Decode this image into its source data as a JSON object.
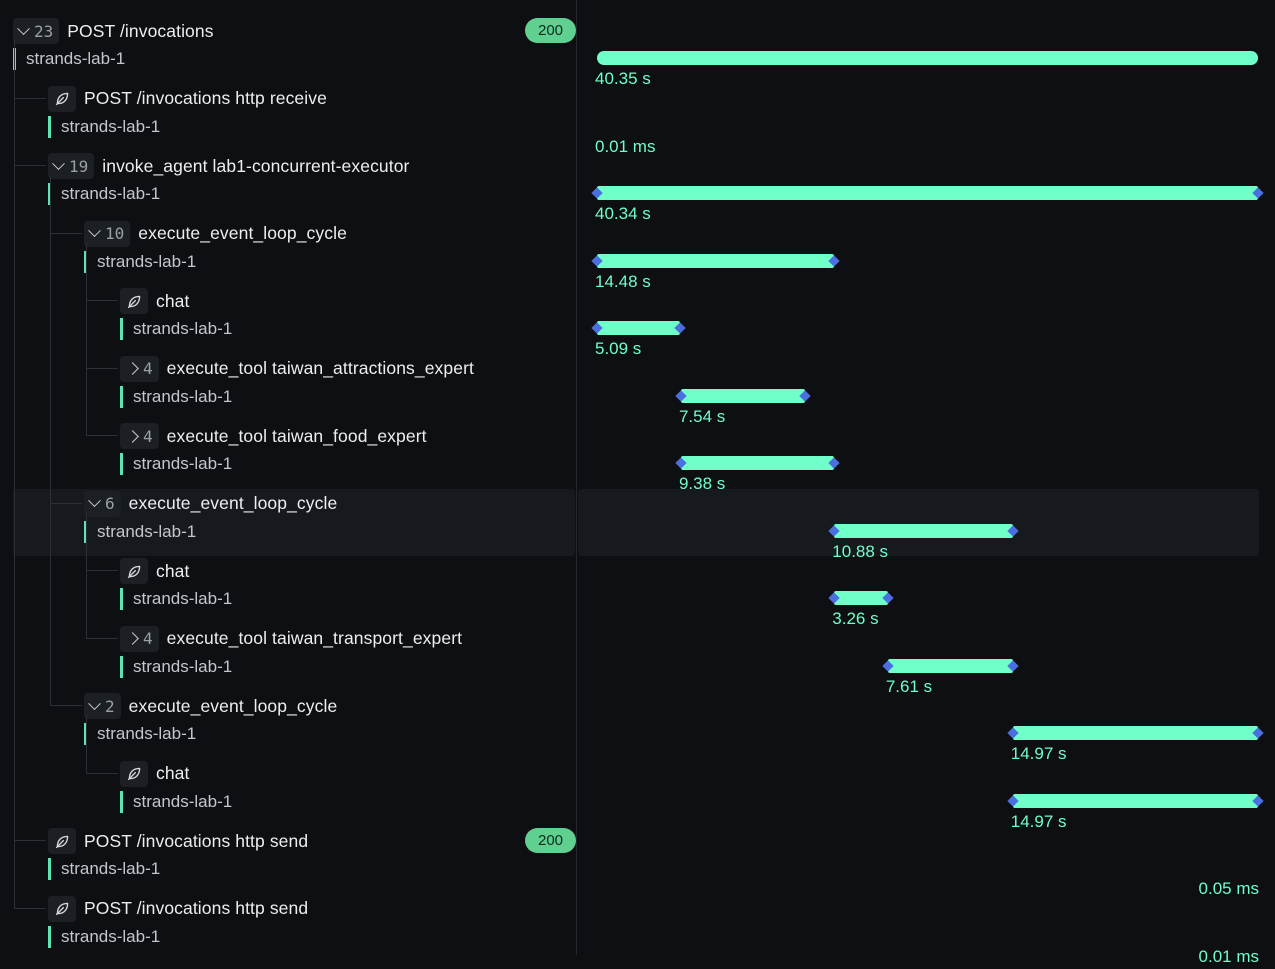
{
  "spans": [
    {
      "name": "POST /invocations",
      "service": "strands-lab-1",
      "depth": 0,
      "kind": "expanded",
      "count": "23",
      "status": "200",
      "duration": "40.35 s",
      "start": 0.0,
      "end": 1.0,
      "endpoints": false
    },
    {
      "name": "POST /invocations http receive",
      "service": "strands-lab-1",
      "depth": 1,
      "kind": "leaf",
      "duration": "0.01 ms",
      "start": 0.0,
      "end": 0.0,
      "endpoints": false
    },
    {
      "name": "invoke_agent lab1-concurrent-executor",
      "service": "strands-lab-1",
      "depth": 1,
      "kind": "expanded",
      "count": "19",
      "duration": "40.34 s",
      "start": 0.0,
      "end": 1.0,
      "endpoints": true
    },
    {
      "name": "execute_event_loop_cycle",
      "service": "strands-lab-1",
      "depth": 2,
      "kind": "expanded",
      "count": "10",
      "duration": "14.48 s",
      "start": 0.0,
      "end": 0.359,
      "endpoints": true
    },
    {
      "name": "chat",
      "service": "strands-lab-1",
      "depth": 3,
      "kind": "leaf",
      "duration": "5.09 s",
      "start": 0.0,
      "end": 0.126,
      "endpoints": true
    },
    {
      "name": "execute_tool taiwan_attractions_expert",
      "service": "strands-lab-1",
      "depth": 3,
      "kind": "collapsed",
      "count": "4",
      "duration": "7.54 s",
      "start": 0.127,
      "end": 0.314,
      "endpoints": true
    },
    {
      "name": "execute_tool taiwan_food_expert",
      "service": "strands-lab-1",
      "depth": 3,
      "kind": "collapsed",
      "count": "4",
      "duration": "9.38 s",
      "start": 0.127,
      "end": 0.359,
      "endpoints": true
    },
    {
      "name": "execute_event_loop_cycle",
      "service": "strands-lab-1",
      "depth": 2,
      "kind": "expanded",
      "count": "6",
      "duration": "10.88 s",
      "start": 0.359,
      "end": 0.629,
      "endpoints": true,
      "selected": true
    },
    {
      "name": "chat",
      "service": "strands-lab-1",
      "depth": 3,
      "kind": "leaf",
      "duration": "3.26 s",
      "start": 0.359,
      "end": 0.44,
      "endpoints": true
    },
    {
      "name": "execute_tool taiwan_transport_expert",
      "service": "strands-lab-1",
      "depth": 3,
      "kind": "collapsed",
      "count": "4",
      "duration": "7.61 s",
      "start": 0.44,
      "end": 0.629,
      "endpoints": true
    },
    {
      "name": "execute_event_loop_cycle",
      "service": "strands-lab-1",
      "depth": 2,
      "kind": "expanded",
      "count": "2",
      "duration": "14.97 s",
      "start": 0.629,
      "end": 1.0,
      "endpoints": true
    },
    {
      "name": "chat",
      "service": "strands-lab-1",
      "depth": 3,
      "kind": "leaf",
      "duration": "14.97 s",
      "start": 0.629,
      "end": 1.0,
      "endpoints": true
    },
    {
      "name": "POST /invocations http send",
      "service": "strands-lab-1",
      "depth": 1,
      "kind": "leaf",
      "status": "200",
      "duration": "0.05 ms",
      "start": 1.0,
      "end": 1.0,
      "endpoints": false,
      "duration_align": "right"
    },
    {
      "name": "POST /invocations http send",
      "service": "strands-lab-1",
      "depth": 1,
      "kind": "leaf",
      "duration": "0.01 ms",
      "start": 1.0,
      "end": 1.0,
      "endpoints": false,
      "duration_align": "right"
    }
  ],
  "icons": {
    "leaf": "leaf-icon",
    "expand": "chevron-down-icon",
    "collapse": "chevron-right-icon"
  },
  "colors": {
    "bar": "#6fffc9",
    "endpoint": "#4b6fe0",
    "service_accent": "#5fe3b0",
    "status_ok": "#5fd08f"
  }
}
